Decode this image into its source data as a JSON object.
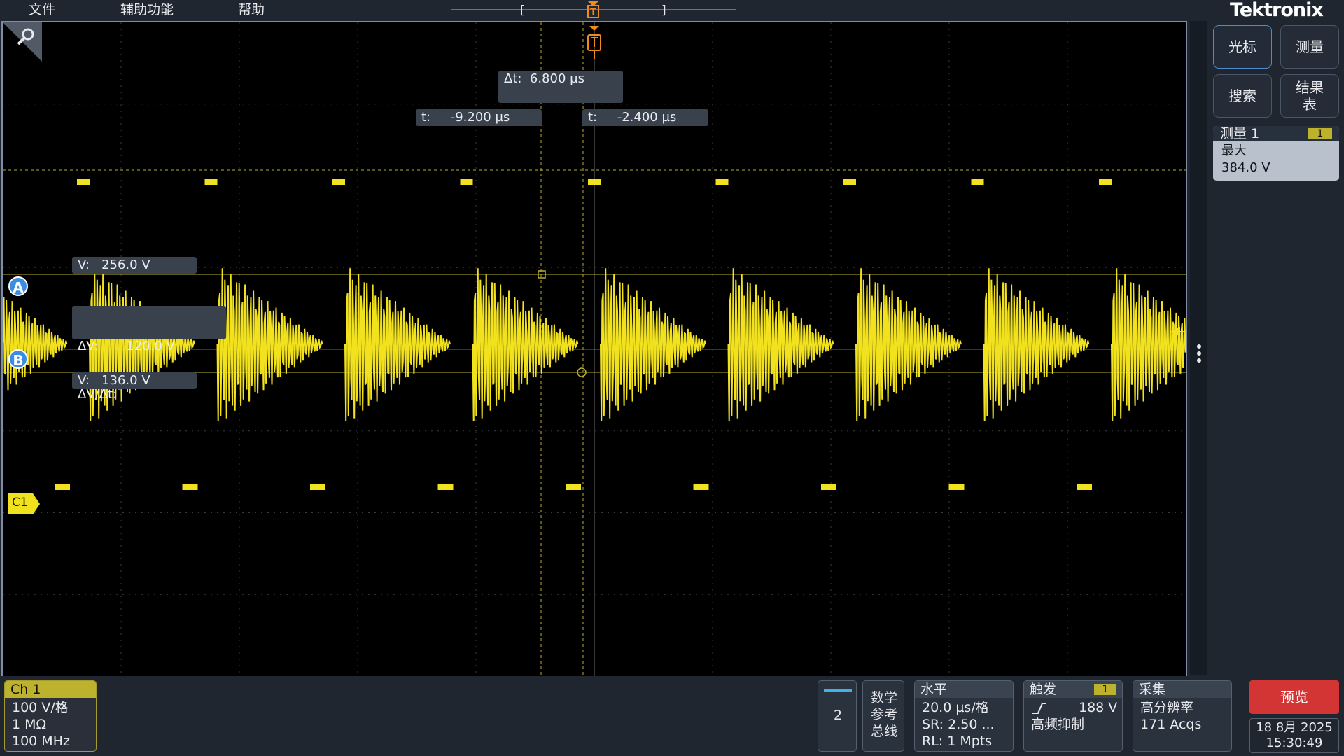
{
  "menu": {
    "file": "文件",
    "utility": "辅助功能",
    "help": "帮助"
  },
  "brand": "Tektronix",
  "trigger_marker_label": "T",
  "record": {
    "left_bracket": "[",
    "right_bracket": "]"
  },
  "cursors": {
    "delta_t": "Δt:  6.800 µs",
    "t_a": "t:     -9.200 µs",
    "t_b": "t:     -2.400 µs",
    "v_a": "V:   256.0 V",
    "delta_v": "ΔV:       120.0 V",
    "dv_dt": "ΔV/Δt:",
    "v_b": "V:   136.0 V",
    "badge_a": "A",
    "badge_b": "B"
  },
  "channel_marker": "C1",
  "right_panel": {
    "cursor_btn": "光标",
    "measure_btn": "测量",
    "search_btn": "搜索",
    "results_btn": "结果表",
    "meas1": {
      "title": "测量 1",
      "channel": "1",
      "type": "最大",
      "value": "384.0 V"
    }
  },
  "bottom": {
    "ch1": {
      "title": "Ch 1",
      "scale": "100 V/格",
      "impedance": "1 MΩ",
      "bandwidth": "100 MHz"
    },
    "add_channel": "2",
    "math_ref_bus": [
      "数学",
      "参考",
      "总线"
    ],
    "horizontal": {
      "title": "水平",
      "scale": "20.0 µs/格",
      "sr": "SR: 2.50 ...",
      "rl": "RL: 1 Mpts"
    },
    "trigger": {
      "title": "触发",
      "channel": "1",
      "level": "188 V",
      "mode": "高频抑制"
    },
    "acquisition": {
      "title": "采集",
      "mode": "高分辨率",
      "count": "171 Acqs"
    },
    "preview": "预览",
    "date": "18 8月 2025",
    "time": "15:30:49"
  },
  "colors": {
    "trace": "#f2e21e",
    "accent_blue": "#3a8de0",
    "trigger_orange": "#f08a1c",
    "preview_red": "#d33434",
    "grid": "#4a4a4a"
  },
  "icons": [
    "zoom-icon",
    "trigger-marker-icon",
    "trigger-edge-icon",
    "more-vertical-icon",
    "trigger-level-arrow-icon"
  ]
}
